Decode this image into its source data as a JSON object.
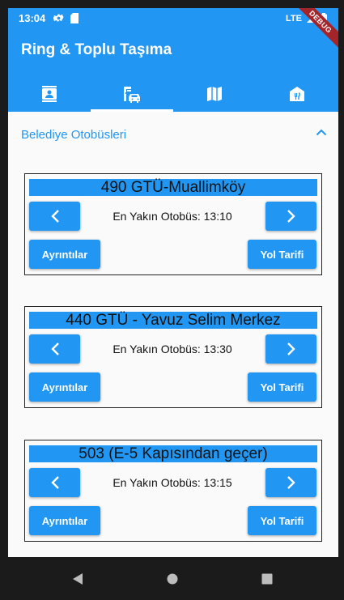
{
  "status_bar": {
    "time": "13:04",
    "network": "LTE",
    "icons": [
      "gear-icon",
      "sd-card-icon",
      "signal-icon",
      "battery-icon"
    ]
  },
  "debug_banner": "DEBUG",
  "app_bar": {
    "title": "Ring & Toplu Taşıma",
    "tabs": [
      {
        "icon": "contact-card-icon",
        "active": false
      },
      {
        "icon": "transit-icon",
        "active": true
      },
      {
        "icon": "map-icon",
        "active": false
      },
      {
        "icon": "restaurant-icon",
        "active": false
      }
    ]
  },
  "section": {
    "title": "Belediye Otobüsleri",
    "expanded": true
  },
  "buses": [
    {
      "name": "490 GTÜ-Muallimköy",
      "next_bus": "En Yakın Otobüs: 13:10",
      "details_label": "Ayrıntılar",
      "route_label": "Yol Tarifi"
    },
    {
      "name": "440 GTÜ - Yavuz Selim Merkez",
      "next_bus": "En Yakın Otobüs: 13:30",
      "details_label": "Ayrıntılar",
      "route_label": "Yol Tarifi"
    },
    {
      "name": "503 (E-5 Kapısından geçer)",
      "next_bus": "En Yakın Otobüs: 13:15",
      "details_label": "Ayrıntılar",
      "route_label": "Yol Tarifi"
    }
  ],
  "colors": {
    "primary": "#2196f3",
    "background": "#fafafa",
    "debug": "#a3252a"
  },
  "nav_bar": [
    "back-icon",
    "home-icon",
    "recents-icon"
  ]
}
